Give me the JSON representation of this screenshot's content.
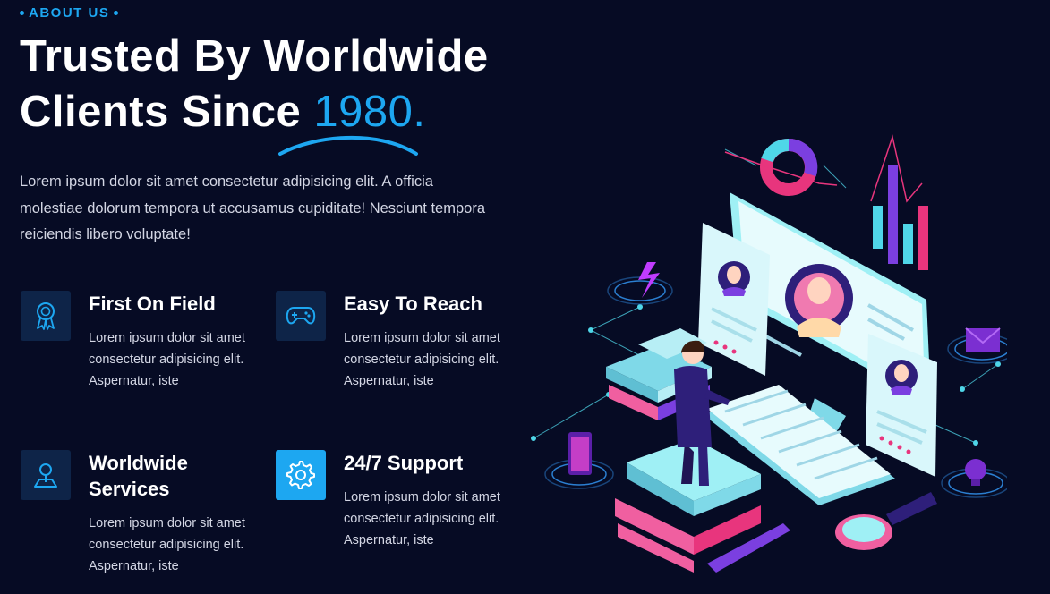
{
  "about": {
    "eyebrow": "ABOUT US",
    "title_line1": "Trusted By Worldwide",
    "title_line2_prefix": "Clients Since ",
    "title_accent": "1980.",
    "intro": "Lorem ipsum dolor sit amet consectetur adipisicing elit. A officia molestiae dolorum tempora ut accusamus cupiditate! Nesciunt tempora reiciendis libero voluptate!"
  },
  "features": [
    {
      "title": "First On Field",
      "desc": "Lorem ipsum dolor sit amet consectetur adipisicing elit. Aspernatur, iste",
      "icon": "award-badge-icon"
    },
    {
      "title": "Easy To Reach",
      "desc": "Lorem ipsum dolor sit amet consectetur adipisicing elit. Aspernatur, iste",
      "icon": "gamepad-icon"
    },
    {
      "title": "Worldwide Services",
      "desc": "Lorem ipsum dolor sit amet consectetur adipisicing elit. Aspernatur, iste",
      "icon": "map-pin-icon"
    },
    {
      "title": "24/7 Support",
      "desc": "Lorem ipsum dolor sit amet consectetur adipisicing elit. Aspernatur, iste",
      "icon": "gear-icon"
    }
  ],
  "colors": {
    "background": "#060b24",
    "accent": "#1da7f1",
    "icon_box": "#0e2448",
    "text": "#d3d6e4"
  }
}
